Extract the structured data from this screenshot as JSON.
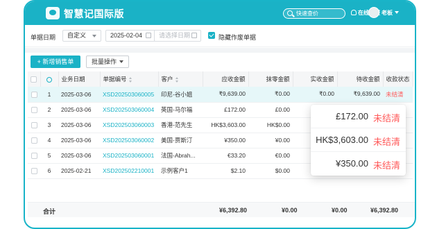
{
  "app": {
    "title": "智慧记国际版",
    "search_placeholder": "快速查价",
    "service": "在线客服",
    "user": "老板"
  },
  "filter": {
    "label": "单据日期",
    "mode": "自定义",
    "start_date": "2025-02-04",
    "end_placeholder": "请选择日期",
    "hide_voided_label": "隐藏作废单据",
    "hide_voided_checked": true
  },
  "toolbar": {
    "new_button": "+ 新增销售单",
    "batch_button": "批量操作"
  },
  "table": {
    "columns": [
      "业务日期",
      "单据编号",
      "客户",
      "应收金额",
      "抹零金额",
      "实收金额",
      "待收金额",
      "收款状态"
    ],
    "rows": [
      {
        "no": "1",
        "date": "2025-03-06",
        "doc": "XSD202503060005",
        "customer": "印尼-谷小姐",
        "receivable": "₹9,639.00",
        "rounding": "₹0.00",
        "received": "₹0.00",
        "pending": "₹9,639.00",
        "status": "未结清"
      },
      {
        "no": "2",
        "date": "2025-03-06",
        "doc": "XSD202503060004",
        "customer": "英国-马尔福",
        "receivable": "£172.00",
        "rounding": "£0.00",
        "received": "",
        "pending": "",
        "status": ""
      },
      {
        "no": "3",
        "date": "2025-03-06",
        "doc": "XSD202503060003",
        "customer": "香港-范先生",
        "receivable": "HK$3,603.00",
        "rounding": "HK$0.00",
        "received": "",
        "pending": "",
        "status": ""
      },
      {
        "no": "4",
        "date": "2025-03-06",
        "doc": "XSD202503060002",
        "customer": "美国-贾斯汀",
        "receivable": "¥350.00",
        "rounding": "¥0.00",
        "received": "",
        "pending": "",
        "status": ""
      },
      {
        "no": "5",
        "date": "2025-03-06",
        "doc": "XSD202503060001",
        "customer": "法国-Abrah...",
        "receivable": "€33.20",
        "rounding": "€0.00",
        "received": "",
        "pending": "",
        "status": ""
      },
      {
        "no": "6",
        "date": "2025-02-21",
        "doc": "XSD202502210001",
        "customer": "示例客户1",
        "receivable": "$2.10",
        "rounding": "$0.00",
        "received": "",
        "pending": "",
        "status": ""
      }
    ]
  },
  "totals": {
    "label": "合计",
    "receivable": "¥6,392.80",
    "rounding": "¥0.00",
    "received": "¥0.00",
    "pending": "¥6,392.80"
  },
  "popup": [
    {
      "amount": "£172.00",
      "status": "未结清"
    },
    {
      "amount": "HK$3,603.00",
      "status": "未结清"
    },
    {
      "amount": "¥350.00",
      "status": "未结清"
    }
  ],
  "colors": {
    "accent": "#1ab2c6",
    "status_unpaid": "#ff5a5a"
  }
}
